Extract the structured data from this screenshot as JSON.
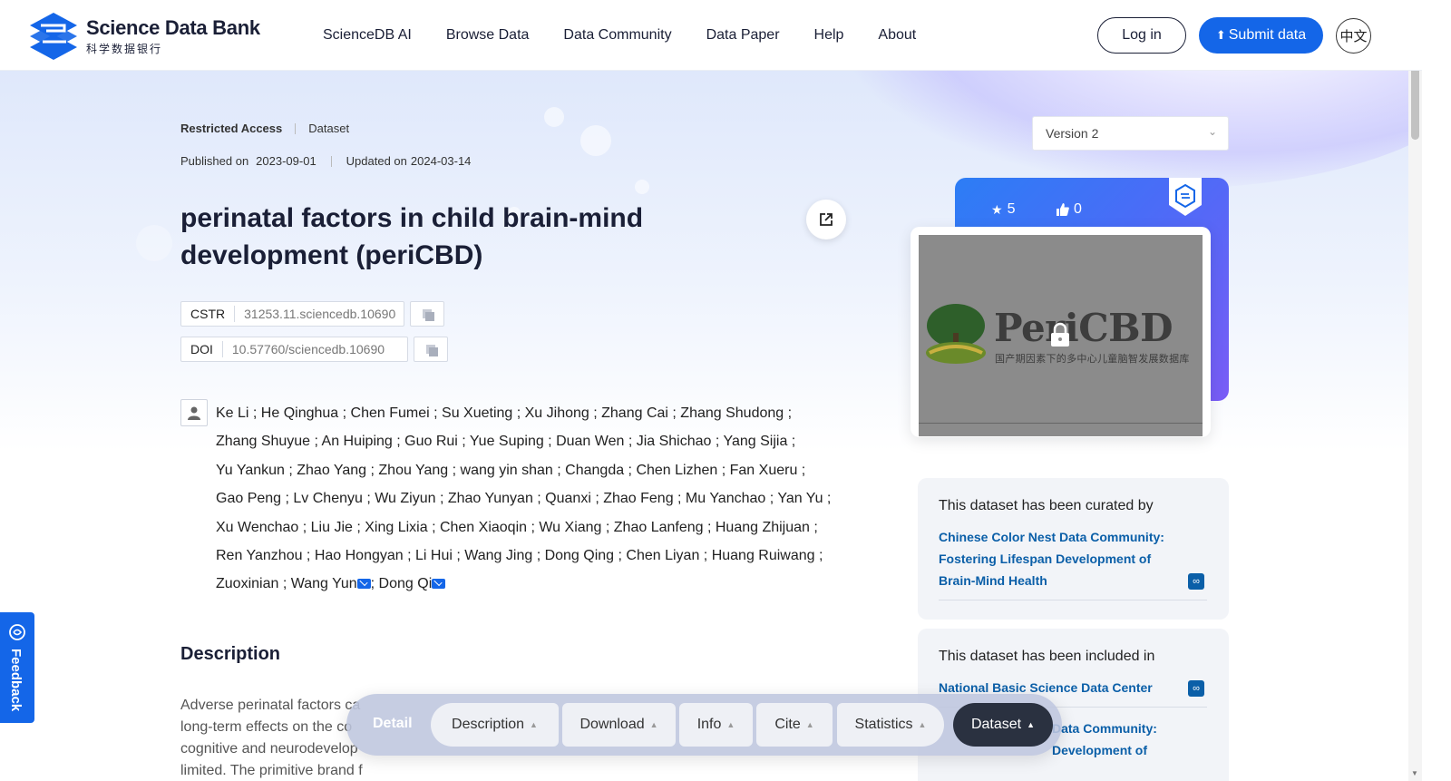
{
  "header": {
    "brand_en": "Science Data Bank",
    "brand_cn": "科学数据银行",
    "nav": [
      "ScienceDB AI",
      "Browse Data",
      "Data Community",
      "Data Paper",
      "Help",
      "About"
    ],
    "login": "Log in",
    "submit": "Submit data",
    "lang": "中文"
  },
  "dataset": {
    "access": "Restricted Access",
    "type": "Dataset",
    "published_label": "Published on",
    "published": "2023-09-01",
    "updated_label": "Updated on",
    "updated": "2024-03-14",
    "title": "perinatal factors in child brain-mind development (periCBD)",
    "cstr_label": "CSTR",
    "cstr": "31253.11.sciencedb.10690",
    "doi_label": "DOI",
    "doi": "10.57760/sciencedb.10690",
    "authors_line1": "Ke Li ; He Qinghua ; Chen Fumei ; Su Xueting ; Xu Jihong ; Zhang Cai ; Zhang Shudong ;",
    "authors_line2": "Zhang Shuyue ; An Huiping ; Guo Rui ; Yue Suping ; Duan Wen ; Jia Shichao ; Yang Sijia ;",
    "authors_line3": "Yu Yankun ; Zhao Yang ; Zhou Yang ; wang yin shan ; Changda ; Chen Lizhen ; Fan Xueru ;",
    "authors_line4": "Gao Peng ; Lv Chenyu ; Wu Ziyun ; Zhao Yunyan ; Quanxi ; Zhao Feng ; Mu Yanchao ; Yan Yu ;",
    "authors_line5": "Xu Wenchao ; Liu Jie ; Xing Lixia ; Chen Xiaoqin ; Wu Xiang ; Zhao Lanfeng ; Huang Zhijuan ;",
    "authors_line6": "Ren Yanzhou ; Hao Hongyan ; Li Hui ; Wang Jing ; Dong Qing ; Chen Liyan ; Huang Ruiwang ;",
    "authors_line7a": "Zuoxinian ; Wang Yun",
    "authors_line7b": "; Dong Qi",
    "description_heading": "Description",
    "description_line1": "Adverse perinatal factors ca",
    "description_line2": "long-term effects on the co",
    "description_line3": "cognitive and neurodevelop",
    "description_line4": "limited. The primitive brand f"
  },
  "sidebar": {
    "version": "Version 2",
    "stars": "5",
    "likes": "0",
    "image_title": "PeriCBD",
    "image_subtitle": "国产期因素下的多中心儿童脑智发展数据库",
    "curated_heading": "This dataset has been curated by",
    "curated_link_l1": "Chinese Color Nest Data Community:",
    "curated_link_l2": "Fostering Lifespan Development of",
    "curated_link_l3": "Brain-Mind Health",
    "included_heading": "This dataset has been included in",
    "included_link": "National Basic Science Data Center",
    "included_link2_l1": "Data Community:",
    "included_link2_l2": "Development of"
  },
  "feedback": "Feedback",
  "tabbar": {
    "detail": "Detail",
    "tabs": [
      "Description",
      "Download",
      "Info",
      "Cite",
      "Statistics",
      "Dataset"
    ]
  },
  "colors": {
    "brand_blue": "#1466e8",
    "link_blue": "#0b5fa8",
    "dark": "#1a1f36"
  }
}
